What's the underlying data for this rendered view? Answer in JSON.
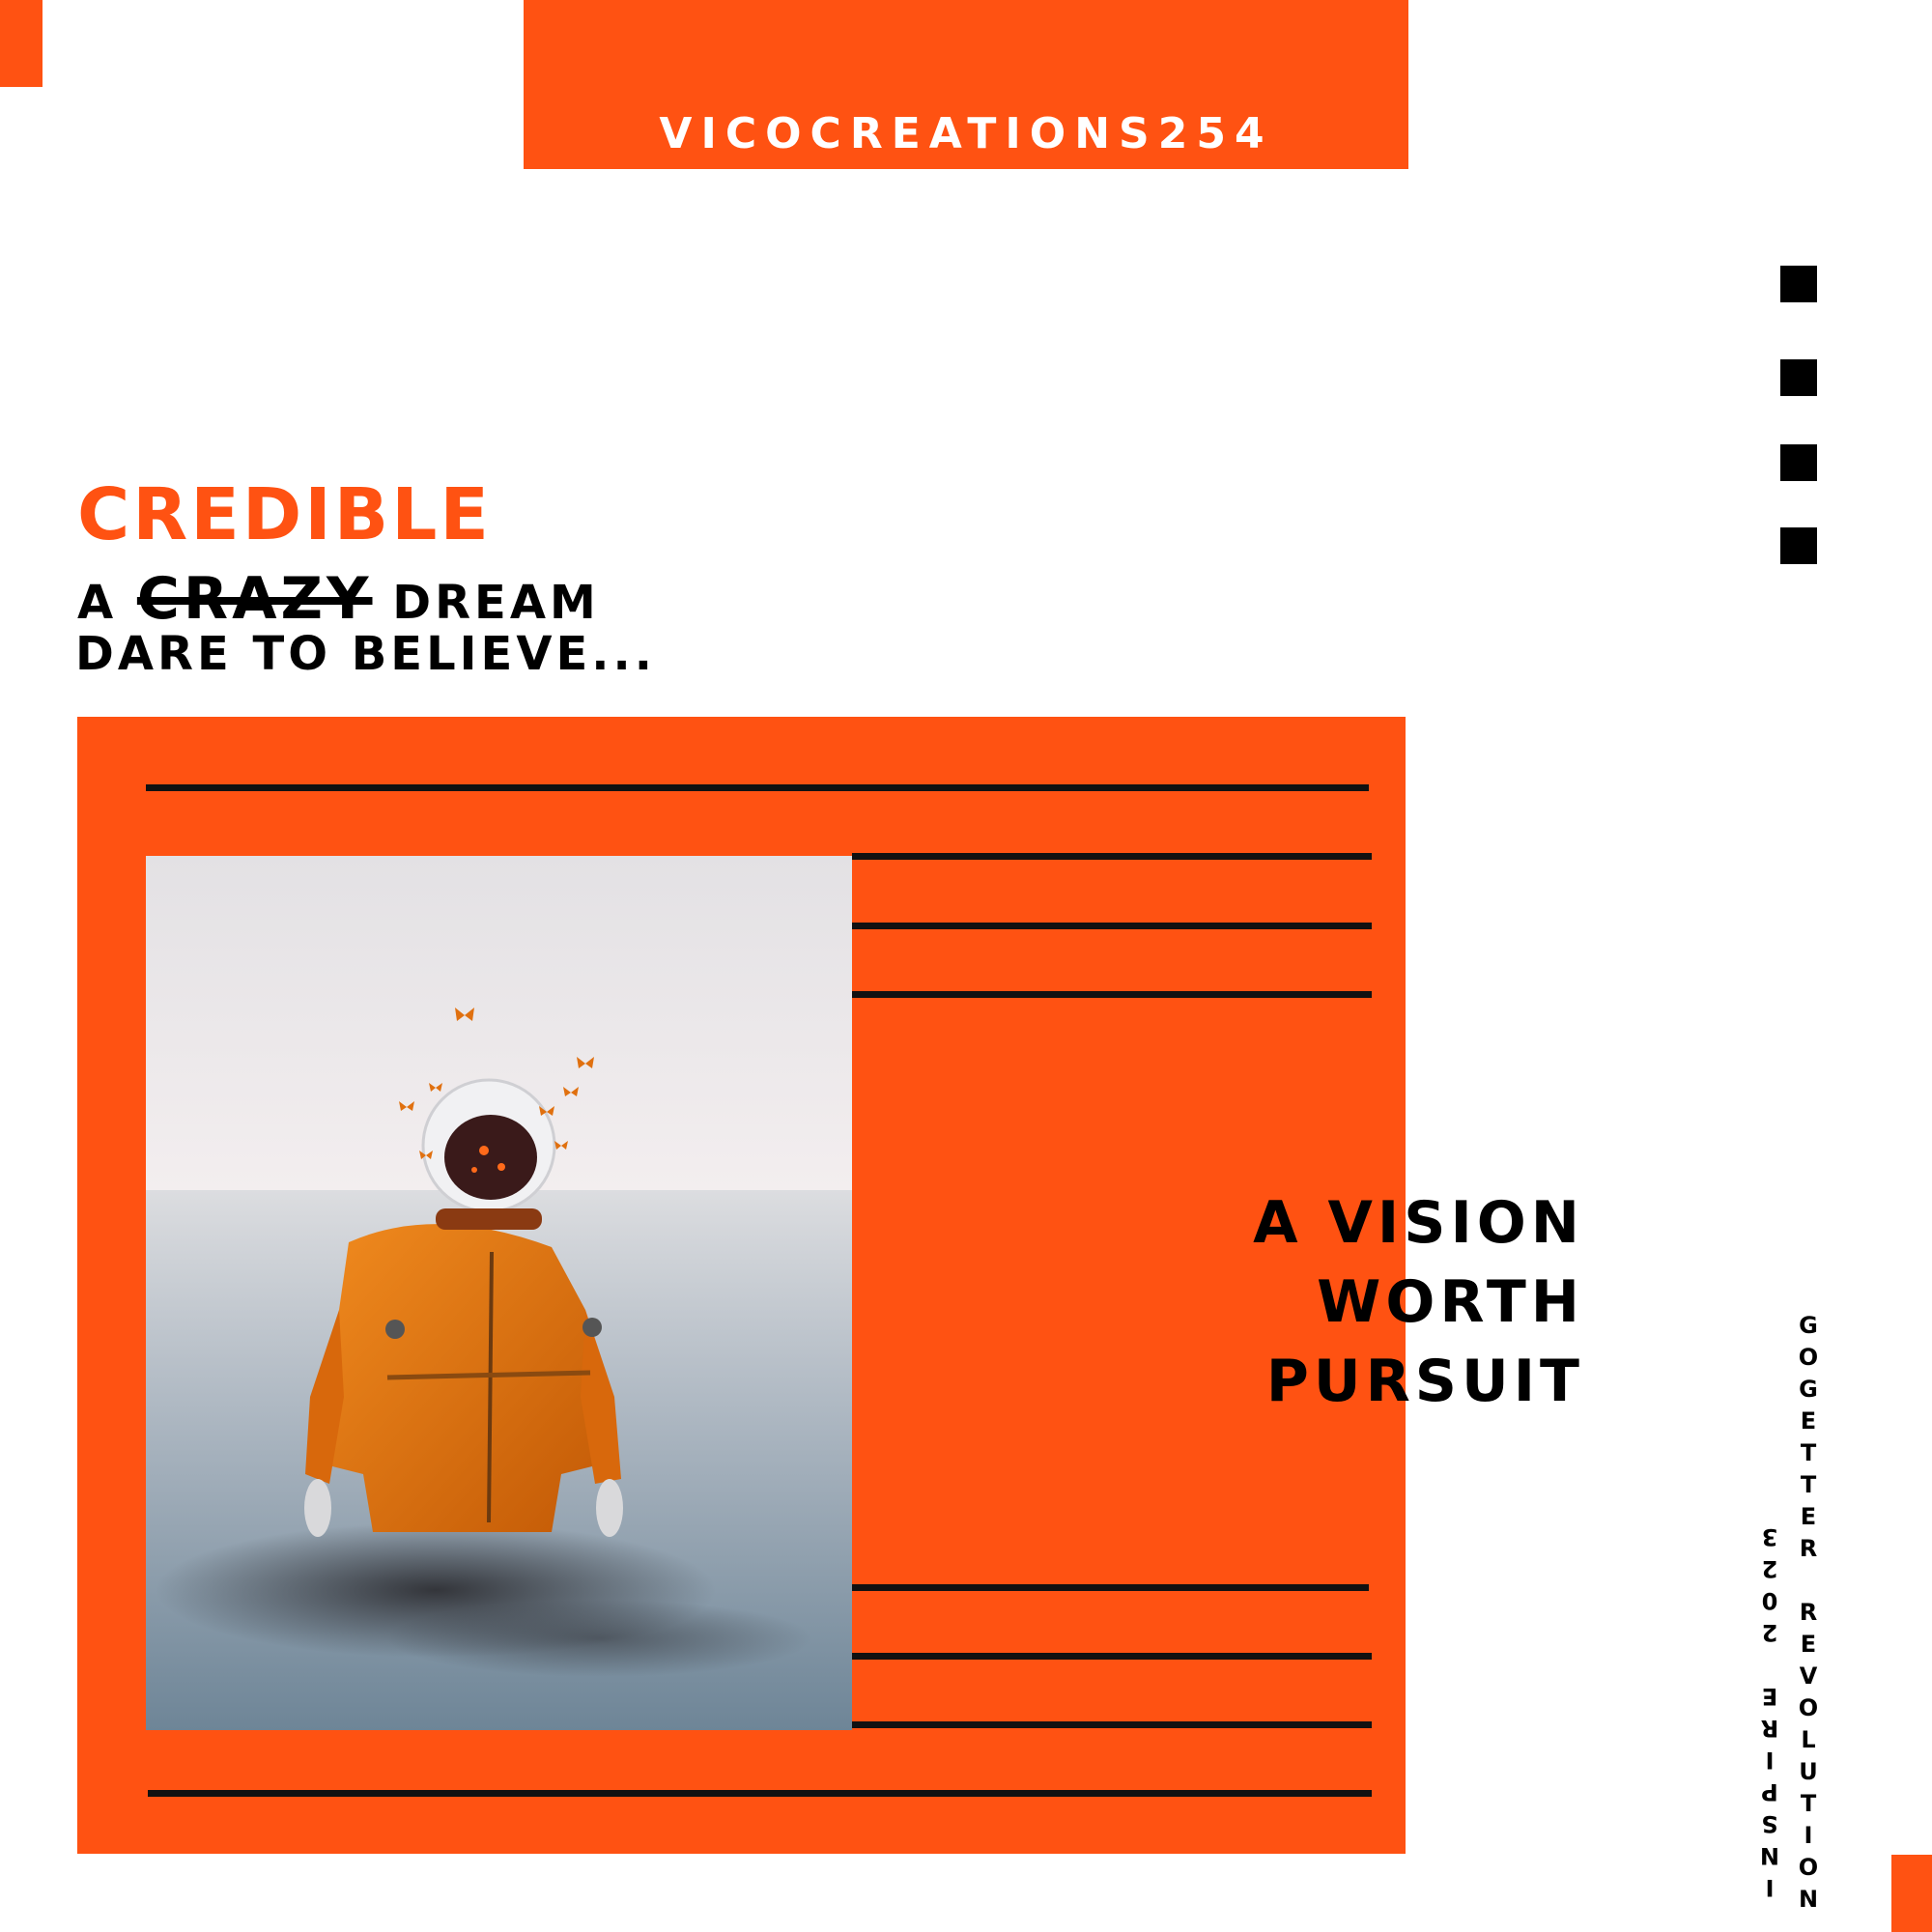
{
  "brand": {
    "name": "VICOCREATIONS254"
  },
  "headline": {
    "accent": "CREDIBLE",
    "line2_prefix": "A",
    "line2_struck": "CRAZY",
    "line2_suffix": "DREAM",
    "line3": "DARE TO BELIEVE..."
  },
  "tagline": {
    "line1": "A VISION",
    "line2": "WORTH",
    "line3": "PURSUIT"
  },
  "side_text": {
    "right": "GOGETTER REVOLUTION",
    "left": "INSPIRE 2023"
  },
  "photo": {
    "icon": "astronaut-in-water-image"
  },
  "colors": {
    "accent": "#ff5212",
    "ink": "#000000",
    "background": "#ffffff"
  }
}
